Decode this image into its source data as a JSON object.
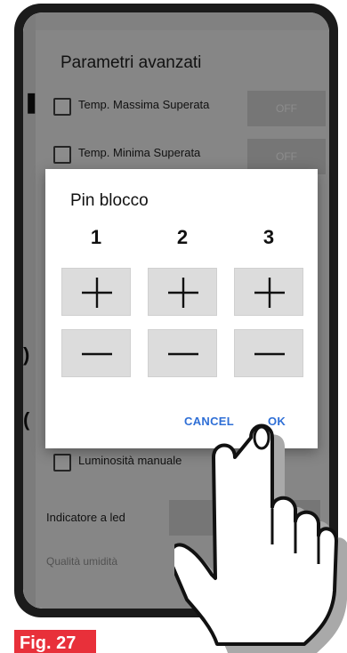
{
  "advanced": {
    "title": "Parametri avanzati",
    "rows": [
      {
        "label": "Temp. Massima Superata",
        "toggle": "OFF"
      },
      {
        "label": "Temp. Minima Superata",
        "toggle": "OFF"
      }
    ],
    "luminosity_label": "Luminosità manuale",
    "led_label": "Indicatore a led",
    "faded_label": "Qualità umidità"
  },
  "dialog": {
    "title": "Pin blocco",
    "columns": [
      "1",
      "2",
      "3"
    ],
    "plus_symbol": "+",
    "minus_symbol": "−",
    "cancel_label": "CANCEL",
    "ok_label": "OK"
  },
  "figure": {
    "label": "Fig. 27"
  },
  "colors": {
    "accent": "#2f6fd6",
    "button_bg": "#dcdcdc",
    "label_red": "#e8303a"
  }
}
